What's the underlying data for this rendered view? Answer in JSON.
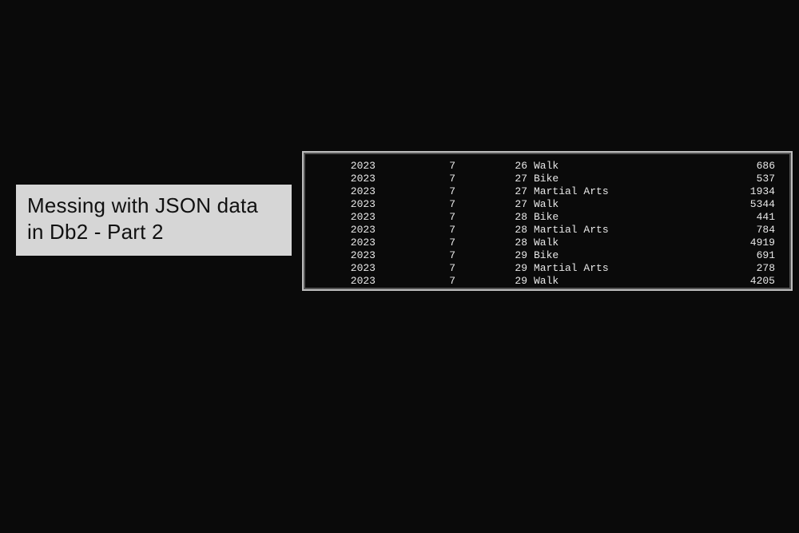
{
  "title": {
    "line1": "Messing with JSON data",
    "line2": "in Db2 - Part 2"
  },
  "terminal": {
    "rows": [
      {
        "year": "2023",
        "month": "7",
        "day": "26",
        "activity": "Walk",
        "value": "686"
      },
      {
        "year": "2023",
        "month": "7",
        "day": "27",
        "activity": "Bike",
        "value": "537"
      },
      {
        "year": "2023",
        "month": "7",
        "day": "27",
        "activity": "Martial Arts",
        "value": "1934"
      },
      {
        "year": "2023",
        "month": "7",
        "day": "27",
        "activity": "Walk",
        "value": "5344"
      },
      {
        "year": "2023",
        "month": "7",
        "day": "28",
        "activity": "Bike",
        "value": "441"
      },
      {
        "year": "2023",
        "month": "7",
        "day": "28",
        "activity": "Martial Arts",
        "value": "784"
      },
      {
        "year": "2023",
        "month": "7",
        "day": "28",
        "activity": "Walk",
        "value": "4919"
      },
      {
        "year": "2023",
        "month": "7",
        "day": "29",
        "activity": "Bike",
        "value": "691"
      },
      {
        "year": "2023",
        "month": "7",
        "day": "29",
        "activity": "Martial Arts",
        "value": "278"
      },
      {
        "year": "2023",
        "month": "7",
        "day": "29",
        "activity": "Walk",
        "value": "4205"
      }
    ]
  }
}
